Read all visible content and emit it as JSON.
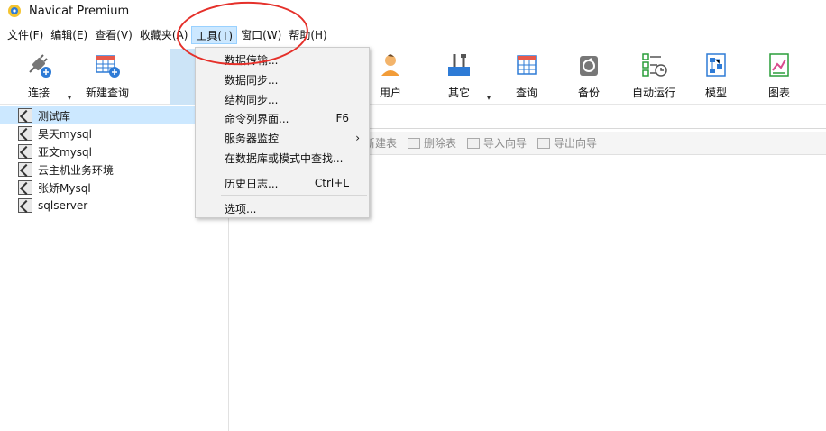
{
  "app": {
    "title": "Navicat Premium",
    "accent": "#cce8ff",
    "annotation_color": "#e5302a"
  },
  "menubar": {
    "items": [
      "文件(F)",
      "编辑(E)",
      "查看(V)",
      "收藏夹(A)",
      "工具(T)",
      "窗口(W)",
      "帮助(H)"
    ]
  },
  "toolbar": {
    "connect": "连接",
    "new_query": "新建查询",
    "user": "用户",
    "other": "其它",
    "query": "查询",
    "backup": "备份",
    "auto_run": "自动运行",
    "model": "模型",
    "chart": "图表"
  },
  "tree": {
    "items": [
      "测试库",
      "昊天mysql",
      "亚文mysql",
      "云主机业务环境",
      "张娇Mysql",
      "sqlserver"
    ]
  },
  "objbar": {
    "new_table": "新建表",
    "delete_table": "删除表",
    "import_wizard": "导入向导",
    "export_wizard": "导出向导"
  },
  "tools_menu": {
    "data_transfer": "数据传输...",
    "data_sync": "数据同步...",
    "structure_sync": "结构同步...",
    "console": "命令列界面...",
    "console_shortcut": "F6",
    "server_monitor": "服务器监控",
    "find_in_db": "在数据库或模式中查找...",
    "history_log": "历史日志...",
    "history_shortcut": "Ctrl+L",
    "options": "选项..."
  }
}
